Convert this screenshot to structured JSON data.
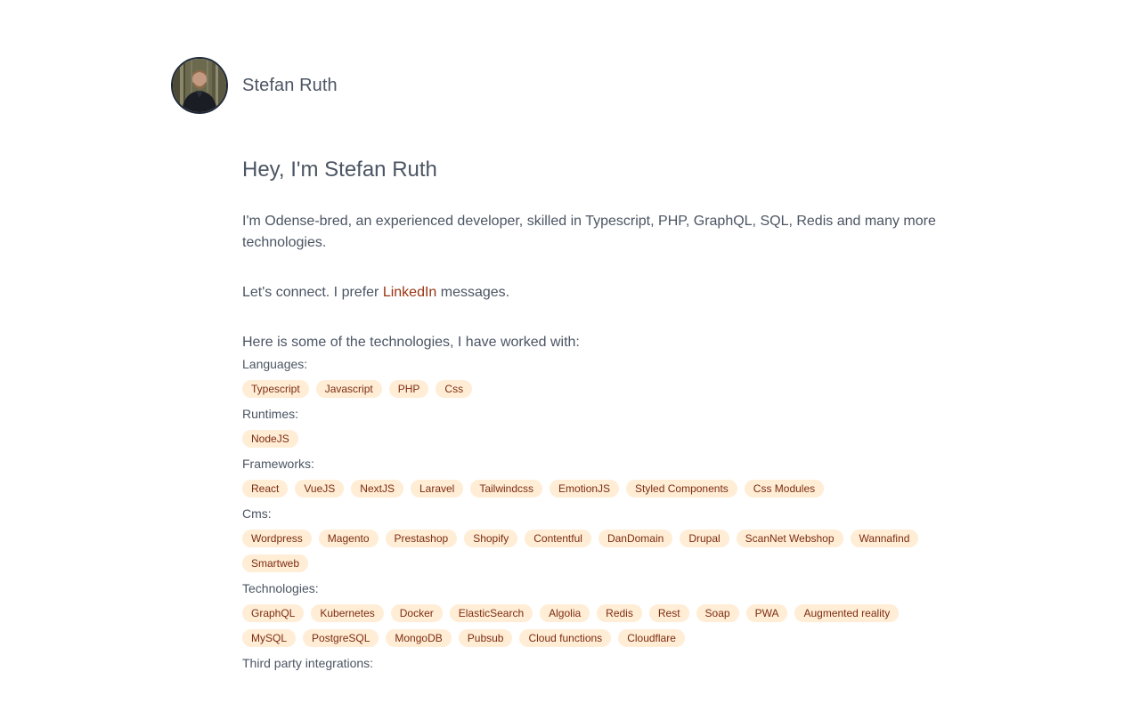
{
  "site": {
    "name": "Stefan Ruth",
    "avatar_alt": "Stefan Ruth"
  },
  "main": {
    "heading": "Hey, I'm Stefan Ruth",
    "intro": "I'm Odense-bred, an experienced developer, skilled in Typescript, PHP, GraphQL, SQL, Redis and many more technologies.",
    "connect_before": "Let's connect. I prefer ",
    "connect_link": "LinkedIn",
    "connect_after": " messages.",
    "tech_intro": "Here is some of the technologies, I have worked with:"
  },
  "groups": [
    {
      "label": "Languages:",
      "tags": [
        "Typescript",
        "Javascript",
        "PHP",
        "Css"
      ]
    },
    {
      "label": "Runtimes:",
      "tags": [
        "NodeJS"
      ]
    },
    {
      "label": "Frameworks:",
      "tags": [
        "React",
        "VueJS",
        "NextJS",
        "Laravel",
        "Tailwindcss",
        "EmotionJS",
        "Styled Components",
        "Css Modules"
      ]
    },
    {
      "label": "Cms:",
      "tags": [
        "Wordpress",
        "Magento",
        "Prestashop",
        "Shopify",
        "Contentful",
        "DanDomain",
        "Drupal",
        "ScanNet Webshop",
        "Wannafind",
        "Smartweb"
      ]
    },
    {
      "label": "Technologies:",
      "tags": [
        "GraphQL",
        "Kubernetes",
        "Docker",
        "ElasticSearch",
        "Algolia",
        "Redis",
        "Rest",
        "Soap",
        "PWA",
        "Augmented reality",
        "MySQL",
        "PostgreSQL",
        "MongoDB",
        "Pubsub",
        "Cloud functions",
        "Cloudflare"
      ]
    },
    {
      "label": "Third party integrations:",
      "tags": []
    }
  ],
  "colors": {
    "text": "#4b5563",
    "link": "#9a3412",
    "tag_bg": "#ffedd5",
    "tag_text": "#7c2d12"
  }
}
